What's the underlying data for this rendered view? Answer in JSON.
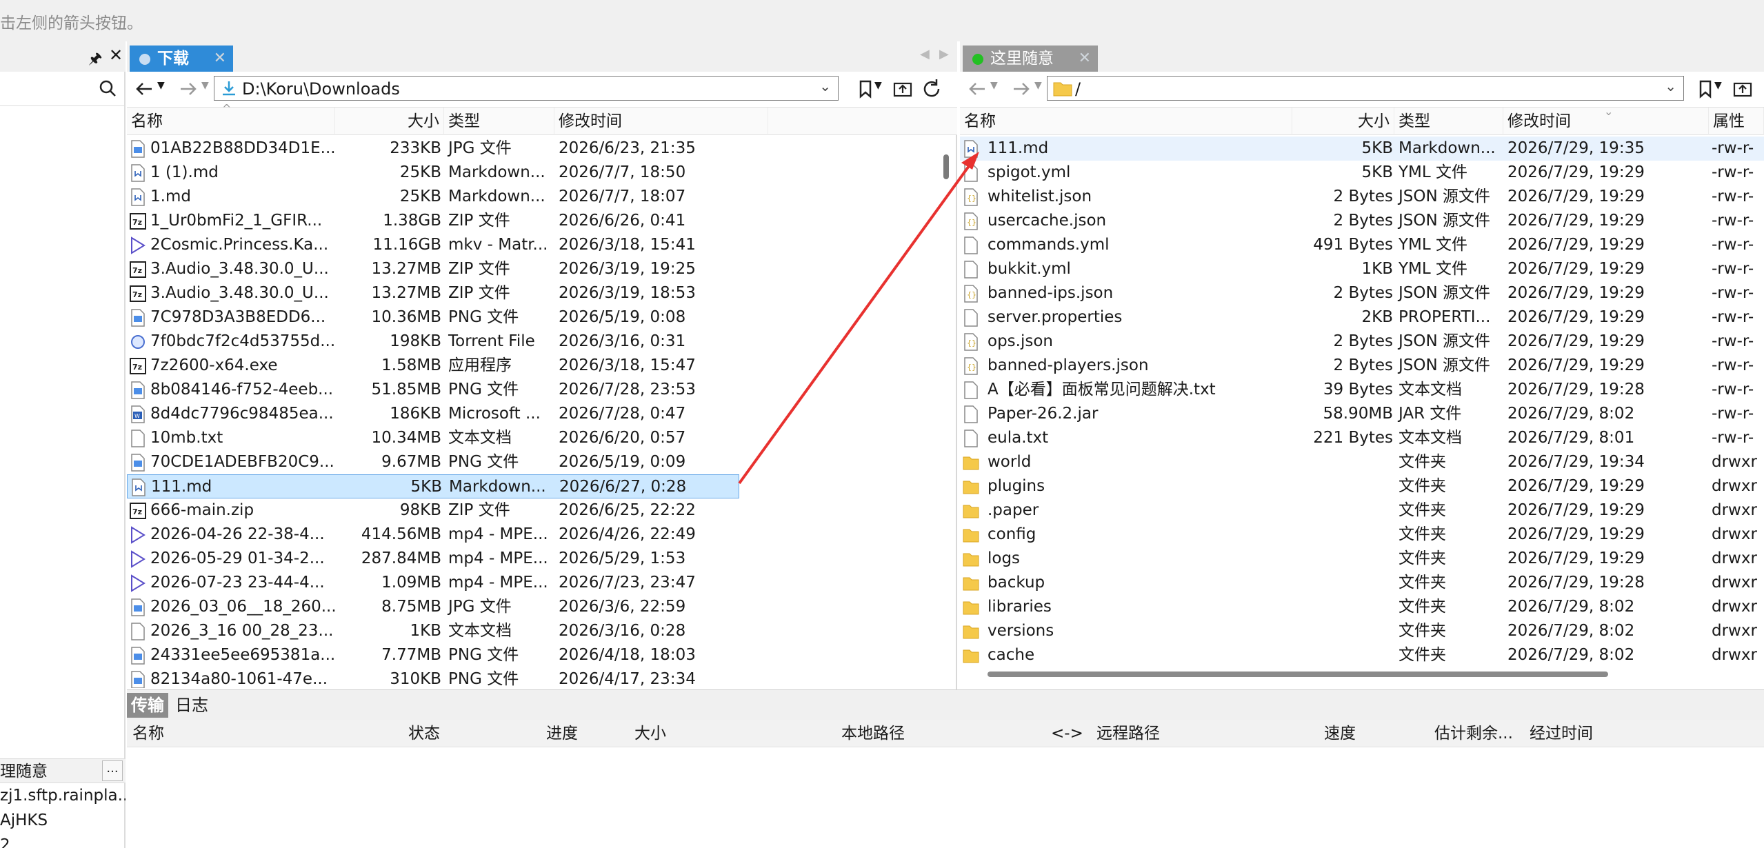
{
  "hint_text": "击左侧的箭头按钮。",
  "left_panel": {
    "pin": "🖈",
    "close": "✕",
    "sessions_header": "理随意",
    "more": "...",
    "items": [
      "zj1.sftp.rainpla...",
      "AjHKS",
      "2"
    ]
  },
  "local": {
    "tab_label": "下载",
    "tab_dot_color": "#c9ddf2",
    "tab_bg": "#2f8bd8",
    "path": "D:\\Koru\\Downloads",
    "columns": [
      "名称",
      "大小",
      "类型",
      "修改时间"
    ],
    "files": [
      {
        "name": "01AB22B88DD34D1E...",
        "size": "233KB",
        "type": "JPG 文件",
        "modified": "2026/6/23, 21:35",
        "icon": "image-file-icon"
      },
      {
        "name": "1 (1).md",
        "size": "25KB",
        "type": "Markdown...",
        "modified": "2026/7/7, 18:50",
        "icon": "markdown-file-icon"
      },
      {
        "name": "1.md",
        "size": "25KB",
        "type": "Markdown...",
        "modified": "2026/7/7, 18:07",
        "icon": "markdown-file-icon"
      },
      {
        "name": "1_Ur0bmFi2_1_GFIR...",
        "size": "1.38GB",
        "type": "ZIP 文件",
        "modified": "2026/6/26, 0:41",
        "icon": "7z-archive-icon"
      },
      {
        "name": "2Cosmic.Princess.Ka...",
        "size": "11.16GB",
        "type": "mkv - Matr...",
        "modified": "2026/3/18, 15:41",
        "icon": "video-file-icon"
      },
      {
        "name": "3.Audio_3.48.30.0_U...",
        "size": "13.27MB",
        "type": "ZIP 文件",
        "modified": "2026/3/19, 19:25",
        "icon": "7z-archive-icon"
      },
      {
        "name": "3.Audio_3.48.30.0_U...",
        "size": "13.27MB",
        "type": "ZIP 文件",
        "modified": "2026/3/19, 18:53",
        "icon": "7z-archive-icon"
      },
      {
        "name": "7C978D3A3B8EDD6...",
        "size": "10.36MB",
        "type": "PNG 文件",
        "modified": "2026/5/19, 0:08",
        "icon": "image-file-icon"
      },
      {
        "name": "7f0bdc7f2c4d53755d...",
        "size": "198KB",
        "type": "Torrent File",
        "modified": "2026/3/16, 0:31",
        "icon": "torrent-file-icon"
      },
      {
        "name": "7z2600-x64.exe",
        "size": "1.58MB",
        "type": "应用程序",
        "modified": "2026/3/18, 15:47",
        "icon": "7z-archive-icon"
      },
      {
        "name": "8b084146-f752-4eeb...",
        "size": "51.85MB",
        "type": "PNG 文件",
        "modified": "2026/7/28, 23:53",
        "icon": "image-file-icon"
      },
      {
        "name": "8d4dc7796c98485ea...",
        "size": "186KB",
        "type": "Microsoft ...",
        "modified": "2026/7/28, 0:47",
        "icon": "word-file-icon"
      },
      {
        "name": "10mb.txt",
        "size": "10.34MB",
        "type": "文本文档",
        "modified": "2026/6/20, 0:57",
        "icon": "text-file-icon"
      },
      {
        "name": "70CDE1ADEBFB20C9...",
        "size": "9.67MB",
        "type": "PNG 文件",
        "modified": "2026/5/19, 0:09",
        "icon": "image-file-icon"
      },
      {
        "name": "111.md",
        "size": "5KB",
        "type": "Markdown...",
        "modified": "2026/6/27, 0:28",
        "icon": "markdown-file-icon",
        "selected": true
      },
      {
        "name": "666-main.zip",
        "size": "98KB",
        "type": "ZIP 文件",
        "modified": "2026/6/25, 22:22",
        "icon": "7z-archive-icon"
      },
      {
        "name": "2026-04-26 22-38-4...",
        "size": "414.56MB",
        "type": "mp4 - MPE...",
        "modified": "2026/4/26, 22:49",
        "icon": "video-file-icon"
      },
      {
        "name": "2026-05-29 01-34-2...",
        "size": "287.84MB",
        "type": "mp4 - MPE...",
        "modified": "2026/5/29, 1:53",
        "icon": "video-file-icon"
      },
      {
        "name": "2026-07-23 23-44-4...",
        "size": "1.09MB",
        "type": "mp4 - MPE...",
        "modified": "2026/7/23, 23:47",
        "icon": "video-file-icon"
      },
      {
        "name": "2026_03_06__18_260...",
        "size": "8.75MB",
        "type": "JPG 文件",
        "modified": "2026/3/6, 22:59",
        "icon": "image-file-icon"
      },
      {
        "name": "2026_3_16 00_28_23...",
        "size": "1KB",
        "type": "文本文档",
        "modified": "2026/3/16, 0:28",
        "icon": "text-file-icon"
      },
      {
        "name": "24331ee5ee695381a...",
        "size": "7.77MB",
        "type": "PNG 文件",
        "modified": "2026/4/18, 18:03",
        "icon": "image-file-icon"
      },
      {
        "name": "82134a80-1061-47e...",
        "size": "310KB",
        "type": "PNG 文件",
        "modified": "2026/4/17, 23:34",
        "icon": "image-file-icon"
      }
    ]
  },
  "remote": {
    "tab_label": "这里随意",
    "tab_dot_color": "#22c022",
    "tab_bg": "#9a9a9a",
    "path": "/",
    "columns": [
      "名称",
      "大小",
      "类型",
      "修改时间",
      "属性"
    ],
    "files": [
      {
        "name": "111.md",
        "size": "5KB",
        "type": "Markdown...",
        "modified": "2026/7/29, 19:35",
        "perm": "-rw-r-",
        "icon": "markdown-file-icon",
        "highlighted": true
      },
      {
        "name": "spigot.yml",
        "size": "5KB",
        "type": "YML 文件",
        "modified": "2026/7/29, 19:29",
        "perm": "-rw-r-",
        "icon": "text-file-icon"
      },
      {
        "name": "whitelist.json",
        "size": "2 Bytes",
        "type": "JSON 源文件",
        "modified": "2026/7/29, 19:29",
        "perm": "-rw-r-",
        "icon": "json-file-icon"
      },
      {
        "name": "usercache.json",
        "size": "2 Bytes",
        "type": "JSON 源文件",
        "modified": "2026/7/29, 19:29",
        "perm": "-rw-r-",
        "icon": "json-file-icon"
      },
      {
        "name": "commands.yml",
        "size": "491 Bytes",
        "type": "YML 文件",
        "modified": "2026/7/29, 19:29",
        "perm": "-rw-r-",
        "icon": "text-file-icon"
      },
      {
        "name": "bukkit.yml",
        "size": "1KB",
        "type": "YML 文件",
        "modified": "2026/7/29, 19:29",
        "perm": "-rw-r-",
        "icon": "text-file-icon"
      },
      {
        "name": "banned-ips.json",
        "size": "2 Bytes",
        "type": "JSON 源文件",
        "modified": "2026/7/29, 19:29",
        "perm": "-rw-r-",
        "icon": "json-file-icon"
      },
      {
        "name": "server.properties",
        "size": "2KB",
        "type": "PROPERTI...",
        "modified": "2026/7/29, 19:29",
        "perm": "-rw-r-",
        "icon": "text-file-icon"
      },
      {
        "name": "ops.json",
        "size": "2 Bytes",
        "type": "JSON 源文件",
        "modified": "2026/7/29, 19:29",
        "perm": "-rw-r-",
        "icon": "json-file-icon"
      },
      {
        "name": "banned-players.json",
        "size": "2 Bytes",
        "type": "JSON 源文件",
        "modified": "2026/7/29, 19:29",
        "perm": "-rw-r-",
        "icon": "json-file-icon"
      },
      {
        "name": "A【必看】面板常见问题解决.txt",
        "size": "39 Bytes",
        "type": "文本文档",
        "modified": "2026/7/29, 19:28",
        "perm": "-rw-r-",
        "icon": "text-file-icon"
      },
      {
        "name": "Paper-26.2.jar",
        "size": "58.90MB",
        "type": "JAR 文件",
        "modified": "2026/7/29, 8:02",
        "perm": "-rw-r-",
        "icon": "text-file-icon"
      },
      {
        "name": "eula.txt",
        "size": "221 Bytes",
        "type": "文本文档",
        "modified": "2026/7/29, 8:01",
        "perm": "-rw-r-",
        "icon": "text-file-icon"
      },
      {
        "name": "world",
        "size": "",
        "type": "文件夹",
        "modified": "2026/7/29, 19:34",
        "perm": "drwxr",
        "icon": "folder-icon"
      },
      {
        "name": "plugins",
        "size": "",
        "type": "文件夹",
        "modified": "2026/7/29, 19:29",
        "perm": "drwxr",
        "icon": "folder-icon"
      },
      {
        "name": ".paper",
        "size": "",
        "type": "文件夹",
        "modified": "2026/7/29, 19:29",
        "perm": "drwxr",
        "icon": "folder-icon"
      },
      {
        "name": "config",
        "size": "",
        "type": "文件夹",
        "modified": "2026/7/29, 19:29",
        "perm": "drwxr",
        "icon": "folder-icon"
      },
      {
        "name": "logs",
        "size": "",
        "type": "文件夹",
        "modified": "2026/7/29, 19:29",
        "perm": "drwxr",
        "icon": "folder-icon"
      },
      {
        "name": "backup",
        "size": "",
        "type": "文件夹",
        "modified": "2026/7/29, 19:28",
        "perm": "drwxr",
        "icon": "folder-icon"
      },
      {
        "name": "libraries",
        "size": "",
        "type": "文件夹",
        "modified": "2026/7/29, 8:02",
        "perm": "drwxr",
        "icon": "folder-icon"
      },
      {
        "name": "versions",
        "size": "",
        "type": "文件夹",
        "modified": "2026/7/29, 8:02",
        "perm": "drwxr",
        "icon": "folder-icon"
      },
      {
        "name": "cache",
        "size": "",
        "type": "文件夹",
        "modified": "2026/7/29, 8:02",
        "perm": "drwxr",
        "icon": "folder-icon"
      }
    ]
  },
  "transfer": {
    "tabs": [
      "传输",
      "日志"
    ],
    "columns": [
      "名称",
      "状态",
      "进度",
      "大小",
      "本地路径",
      "<->",
      "远程路径",
      "速度",
      "估计剩余...",
      "经过时间"
    ]
  },
  "annotation": {
    "arrow_color": "#e8312f"
  }
}
